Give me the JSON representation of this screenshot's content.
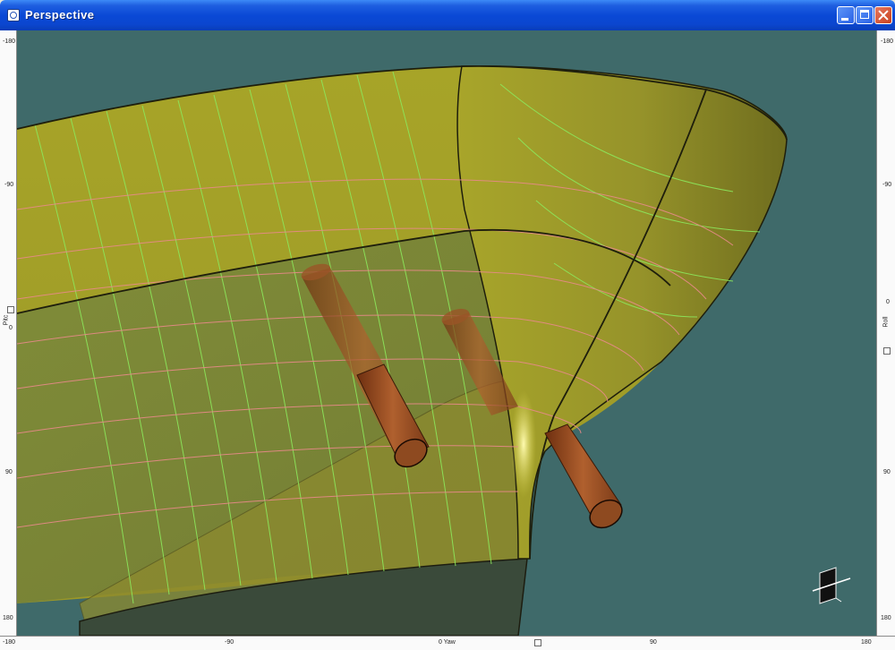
{
  "window": {
    "title": "Perspective"
  },
  "rulers": {
    "left_ticks": [
      "-180",
      "-90",
      "0",
      "90",
      "180"
    ],
    "left_axis_label": "Pitc",
    "right_ticks": [
      "-180",
      "-90",
      "0",
      "90",
      "180"
    ],
    "right_axis_label": "Roll",
    "bottom_ticks": [
      "-180",
      "-90",
      "0 Yaw",
      "90",
      "180"
    ]
  },
  "colors": {
    "viewport_bg": "#3f6a6a",
    "hull": "#a9a428",
    "hull_dark": "#7c7a22",
    "thruster": "#a85a2a",
    "stations": "#8ce85c",
    "waterlines": "#e88a8a"
  },
  "icons": {
    "orientation_gizmo": "axis-gizmo-icon"
  }
}
